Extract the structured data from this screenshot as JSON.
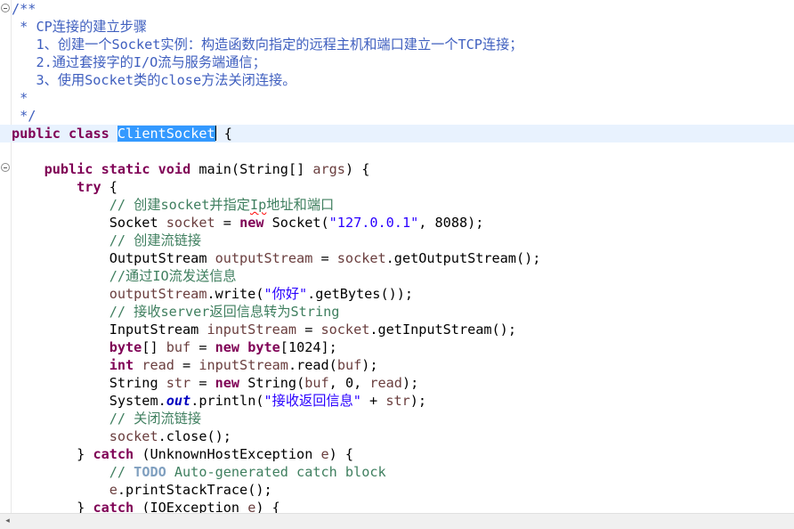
{
  "editor": {
    "language": "java",
    "selected_text": "ClientSocket",
    "lines": [
      {
        "indent": "",
        "tokens": [
          {
            "t": "/**",
            "c": "doc"
          }
        ]
      },
      {
        "indent": " ",
        "tokens": [
          {
            "t": "* CP连接的建立步骤",
            "c": "doc"
          }
        ]
      },
      {
        "indent": "   ",
        "tokens": [
          {
            "t": "1、创建一个Socket实例：构造函数向指定的远程主机和端口建立一个TCP连接；",
            "c": "doc"
          }
        ]
      },
      {
        "indent": "   ",
        "tokens": [
          {
            "t": "2.通过套接字的I/O流与服务端通信；",
            "c": "doc"
          }
        ]
      },
      {
        "indent": "   ",
        "tokens": [
          {
            "t": "3、使用Socket类的close方法关闭连接。",
            "c": "doc"
          }
        ]
      },
      {
        "indent": " ",
        "tokens": [
          {
            "t": "*",
            "c": "doc"
          }
        ]
      },
      {
        "indent": " ",
        "tokens": [
          {
            "t": "*/",
            "c": "doc"
          }
        ]
      },
      {
        "indent": "",
        "current": true,
        "tokens": [
          {
            "t": "public",
            "c": "kw"
          },
          {
            "t": " "
          },
          {
            "t": "class",
            "c": "kw"
          },
          {
            "t": " "
          },
          {
            "t": "ClientSocket",
            "c": "sel"
          },
          {
            "caret": true
          },
          {
            "t": " {"
          }
        ]
      },
      {
        "indent": "",
        "tokens": []
      },
      {
        "indent": "    ",
        "tokens": [
          {
            "t": "public",
            "c": "kw"
          },
          {
            "t": " "
          },
          {
            "t": "static",
            "c": "kw"
          },
          {
            "t": " "
          },
          {
            "t": "void",
            "c": "kw"
          },
          {
            "t": " main(String[] "
          },
          {
            "t": "args",
            "c": "var"
          },
          {
            "t": ") {"
          }
        ]
      },
      {
        "indent": "        ",
        "tokens": [
          {
            "t": "try",
            "c": "kw"
          },
          {
            "t": " {"
          }
        ]
      },
      {
        "indent": "            ",
        "tokens": [
          {
            "t": "// 创建socket并指定",
            "c": "cmt"
          },
          {
            "t": "Ip",
            "c": "cmt",
            "err": true
          },
          {
            "t": "地址和端口",
            "c": "cmt"
          }
        ]
      },
      {
        "indent": "            ",
        "tokens": [
          {
            "t": "Socket "
          },
          {
            "t": "socket",
            "c": "var"
          },
          {
            "t": " = "
          },
          {
            "t": "new",
            "c": "kw"
          },
          {
            "t": " Socket("
          },
          {
            "t": "\"127.0.0.1\"",
            "c": "str"
          },
          {
            "t": ", 8088);"
          }
        ]
      },
      {
        "indent": "            ",
        "tokens": [
          {
            "t": "// 创建流链接",
            "c": "cmt"
          }
        ]
      },
      {
        "indent": "            ",
        "tokens": [
          {
            "t": "OutputStream "
          },
          {
            "t": "outputStream",
            "c": "var"
          },
          {
            "t": " = "
          },
          {
            "t": "socket",
            "c": "var"
          },
          {
            "t": ".getOutputStream();"
          }
        ]
      },
      {
        "indent": "            ",
        "tokens": [
          {
            "t": "//通过IO流发送信息",
            "c": "cmt"
          }
        ]
      },
      {
        "indent": "            ",
        "tokens": [
          {
            "t": "outputStream",
            "c": "var"
          },
          {
            "t": ".write("
          },
          {
            "t": "\"你好\"",
            "c": "str"
          },
          {
            "t": ".getBytes());"
          }
        ]
      },
      {
        "indent": "            ",
        "tokens": [
          {
            "t": "// 接收server返回信息转为String",
            "c": "cmt"
          }
        ]
      },
      {
        "indent": "            ",
        "tokens": [
          {
            "t": "InputStream "
          },
          {
            "t": "inputStream",
            "c": "var"
          },
          {
            "t": " = "
          },
          {
            "t": "socket",
            "c": "var"
          },
          {
            "t": ".getInputStream();"
          }
        ]
      },
      {
        "indent": "            ",
        "tokens": [
          {
            "t": "byte",
            "c": "kw"
          },
          {
            "t": "[] "
          },
          {
            "t": "buf",
            "c": "var"
          },
          {
            "t": " = "
          },
          {
            "t": "new",
            "c": "kw"
          },
          {
            "t": " "
          },
          {
            "t": "byte",
            "c": "kw"
          },
          {
            "t": "[1024];"
          }
        ]
      },
      {
        "indent": "            ",
        "tokens": [
          {
            "t": "int",
            "c": "kw"
          },
          {
            "t": " "
          },
          {
            "t": "read",
            "c": "var"
          },
          {
            "t": " = "
          },
          {
            "t": "inputStream",
            "c": "var"
          },
          {
            "t": ".read("
          },
          {
            "t": "buf",
            "c": "var"
          },
          {
            "t": ");"
          }
        ]
      },
      {
        "indent": "            ",
        "tokens": [
          {
            "t": "String "
          },
          {
            "t": "str",
            "c": "var"
          },
          {
            "t": " = "
          },
          {
            "t": "new",
            "c": "kw"
          },
          {
            "t": " String("
          },
          {
            "t": "buf",
            "c": "var"
          },
          {
            "t": ", 0, "
          },
          {
            "t": "read",
            "c": "var"
          },
          {
            "t": ");"
          }
        ]
      },
      {
        "indent": "            ",
        "tokens": [
          {
            "t": "System."
          },
          {
            "t": "out",
            "c": "field"
          },
          {
            "t": ".println("
          },
          {
            "t": "\"接收返回信息\"",
            "c": "str"
          },
          {
            "t": " + "
          },
          {
            "t": "str",
            "c": "var"
          },
          {
            "t": ");"
          }
        ]
      },
      {
        "indent": "            ",
        "tokens": [
          {
            "t": "// 关闭流链接",
            "c": "cmt"
          }
        ]
      },
      {
        "indent": "            ",
        "tokens": [
          {
            "t": "socket",
            "c": "var"
          },
          {
            "t": ".close();"
          }
        ]
      },
      {
        "indent": "        ",
        "tokens": [
          {
            "t": "} "
          },
          {
            "t": "catch",
            "c": "kw"
          },
          {
            "t": " (UnknownHostException "
          },
          {
            "t": "e",
            "c": "var"
          },
          {
            "t": ") {"
          }
        ]
      },
      {
        "indent": "            ",
        "tokens": [
          {
            "t": "// ",
            "c": "cmt"
          },
          {
            "t": "TODO",
            "c": "todo"
          },
          {
            "t": " Auto-generated catch block",
            "c": "cmt"
          }
        ]
      },
      {
        "indent": "            ",
        "tokens": [
          {
            "t": "e",
            "c": "var"
          },
          {
            "t": ".printStackTrace();"
          }
        ]
      },
      {
        "indent": "        ",
        "tokens": [
          {
            "t": "} "
          },
          {
            "t": "catch",
            "c": "kw"
          },
          {
            "t": " (IOException "
          },
          {
            "t": "e",
            "c": "var"
          },
          {
            "t": ") {"
          }
        ]
      }
    ]
  },
  "scrollbar": {
    "left_arrow_icon": "◂"
  },
  "colors": {
    "keyword": "#7f0055",
    "javadoc": "#3f5fbf",
    "comment": "#3f7f5f",
    "string": "#2a00ff",
    "local_variable": "#6a3e3e",
    "static_field": "#0000c0",
    "selection": "#3399ff",
    "current_line": "#e8f2fe"
  }
}
